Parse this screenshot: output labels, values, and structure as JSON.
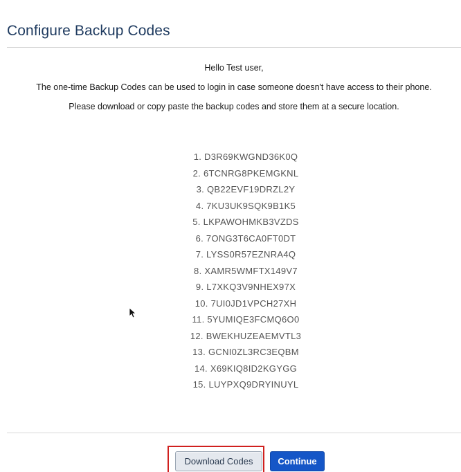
{
  "page": {
    "title": "Configure Backup Codes"
  },
  "intro": {
    "greeting": "Hello Test user,",
    "description": "The one-time Backup Codes can be used to login in case someone doesn't have access to their phone.",
    "instruction": "Please download or copy paste the backup codes and store them at a secure location."
  },
  "codes": [
    "1. D3R69KWGND36K0Q",
    "2. 6TCNRG8PKEMGKNL",
    "3. QB22EVF19DRZL2Y",
    "4. 7KU3UK9SQK9B1K5",
    "5. LKPAWOHMKB3VZDS",
    "6. 7ONG3T6CA0FT0DT",
    "7. LYSS0R57EZNRA4Q",
    "8. XAMR5WMFTX149V7",
    "9. L7XKQ3V9NHEX97X",
    "10. 7UI0JD1VPCH27XH",
    "11. 5YUMIQE3FCMQ6O0",
    "12. BWEKHUZEAEMVTL3",
    "13. GCNI0ZL3RC3EQBM",
    "14. X69KIQ8ID2KGYGG",
    "15. LUYPXQ9DRYINUYL"
  ],
  "actions": {
    "download_label": "Download Codes",
    "continue_label": "Continue"
  },
  "colors": {
    "title": "#1e3a5f",
    "primary": "#1556c7",
    "highlight": "#d0201e"
  },
  "icons": {
    "cursor": "mouse-pointer-icon"
  }
}
